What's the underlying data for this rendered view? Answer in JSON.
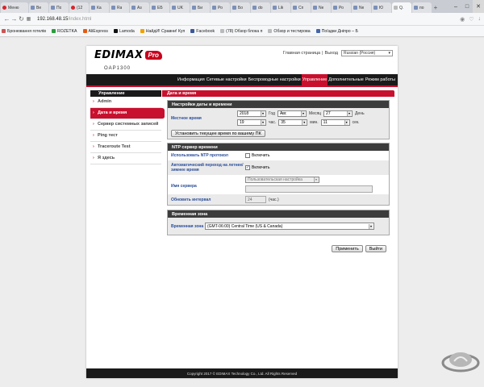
{
  "browser": {
    "tabs": [
      {
        "label": "Меню",
        "kind": "opera"
      },
      {
        "label": "Ве",
        "kind": "doc"
      },
      {
        "label": "По",
        "kind": "doc"
      },
      {
        "label": "(12",
        "kind": "opera"
      },
      {
        "label": "Ка",
        "kind": "doc"
      },
      {
        "label": "Ra",
        "kind": "doc"
      },
      {
        "label": "Аз",
        "kind": "doc"
      },
      {
        "label": "ЕБ",
        "kind": "doc"
      },
      {
        "label": "UK",
        "kind": "doc"
      },
      {
        "label": "Би",
        "kind": "doc"
      },
      {
        "label": "Ро",
        "kind": "doc"
      },
      {
        "label": "Бо",
        "kind": "doc"
      },
      {
        "label": "do",
        "kind": "doc"
      },
      {
        "label": "Lik",
        "kind": "doc"
      },
      {
        "label": "Cn",
        "kind": "doc"
      },
      {
        "label": "Ne",
        "kind": "doc"
      },
      {
        "label": "Ро",
        "kind": "doc"
      },
      {
        "label": "Ne",
        "kind": "doc"
      },
      {
        "label": "Ю",
        "kind": "doc"
      },
      {
        "label": "Q.",
        "kind": "active"
      },
      {
        "label": "по",
        "kind": "doc"
      }
    ],
    "url_host": "192.168.48.15",
    "url_path": "/index.html",
    "bookmarks": [
      "Бронювання готелів",
      "ROZETKA",
      "AliExpress",
      "Lamoda",
      "НайдИ! Сравни! Куп",
      "Facebook",
      "(78) Обзор блока п",
      "Обзор и тестирова",
      "Поїздки Дніпро – Б"
    ]
  },
  "router": {
    "logo_text": "EDIMAX",
    "logo_pro": "Pro",
    "model": "OAP1300",
    "home_link": "Главная страница",
    "logout_link": "Выход",
    "language": "Russian (Россия)",
    "nav": [
      "Информация",
      "Сетевые настройки",
      "Беспроводные настройки",
      "Управление",
      "Дополнительные",
      "Режим работы"
    ],
    "nav_active": "Управление",
    "sidebar_title": "Управление",
    "sidebar": [
      "Admin",
      "Дата и время",
      "Сервер системных записей",
      "Ping тест",
      "Traceroute Test",
      "Я здесь"
    ],
    "sidebar_active": "Дата и время",
    "content_title": "Дата и время",
    "datetime": {
      "title": "Настройки даты и времени",
      "local_time_label": "Местное время",
      "year": "2018",
      "year_unit": "Год",
      "month": "Авг.",
      "month_unit": "Месяц",
      "day": "27",
      "day_unit": "День",
      "hour": "19",
      "hour_unit": "час.",
      "minute": "35",
      "minute_unit": "мин.",
      "second": "11",
      "second_unit": "сек.",
      "sync_button": "Установить текущее время по вашему ПК"
    },
    "ntp": {
      "title": "NTP сервер времени",
      "use_ntp_label": "Использовать NTP протокол",
      "use_ntp_text": "Включить",
      "use_ntp_checked": false,
      "dst_label": "Автоматический переход на летнее/зимнее время",
      "dst_text": "Включить",
      "dst_checked": true,
      "server_label": "Имя сервера",
      "server_select": "Пользовательская настройка",
      "interval_label": "Обновить интервал",
      "interval_value": "24",
      "interval_unit": "(час.)"
    },
    "timezone": {
      "title": "Временная зона",
      "label": "Временная зона",
      "value": "(GMT-06:00) Central Time (US & Canada)"
    },
    "apply_button": "Применить",
    "exit_button": "Выйти",
    "footer": "Copyright 2017 © EDIMAX Technology Co., Ltd. All Rights Reserved"
  },
  "colors": {
    "accent": "#c8102e",
    "dark": "#1a1a1a",
    "label_blue": "#2a4d9a"
  }
}
